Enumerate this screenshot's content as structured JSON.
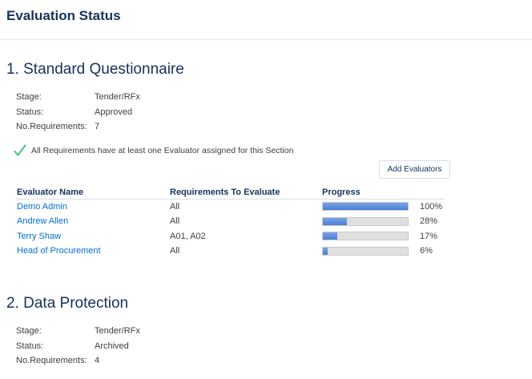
{
  "page": {
    "title": "Evaluation Status"
  },
  "labels": {
    "stage": "Stage:",
    "status": "Status:",
    "requirements": "No.Requirements:"
  },
  "sections": [
    {
      "title": "1. Standard Questionnaire",
      "stage": "Tender/RFx",
      "status": "Approved",
      "requirements": "7",
      "assignment_message": "All Requirements have at least one Evaluator assigned for this Section",
      "add_button_label": "Add Evaluators",
      "table": {
        "headers": [
          "Evaluator Name",
          "Requirements To Evaluate",
          "Progress"
        ],
        "rows": [
          {
            "name": "Demo Admin",
            "requirements": "All",
            "progress": 100,
            "progress_label": "100%"
          },
          {
            "name": "Andrew Allen",
            "requirements": "All",
            "progress": 28,
            "progress_label": "28%"
          },
          {
            "name": "Terry Shaw",
            "requirements": "A01, A02",
            "progress": 17,
            "progress_label": "17%"
          },
          {
            "name": "Head of Procurement",
            "requirements": "All",
            "progress": 6,
            "progress_label": "6%"
          }
        ]
      }
    },
    {
      "title": "2. Data Protection",
      "stage": "Tender/RFx",
      "status": "Archived",
      "requirements": "4"
    }
  ],
  "colors": {
    "heading": "#16325c",
    "link": "#0070d2",
    "progress_fill": "#4a7ed2",
    "check": "#4bca81"
  },
  "icons": {
    "assignment_ok": "checkmark-icon"
  }
}
